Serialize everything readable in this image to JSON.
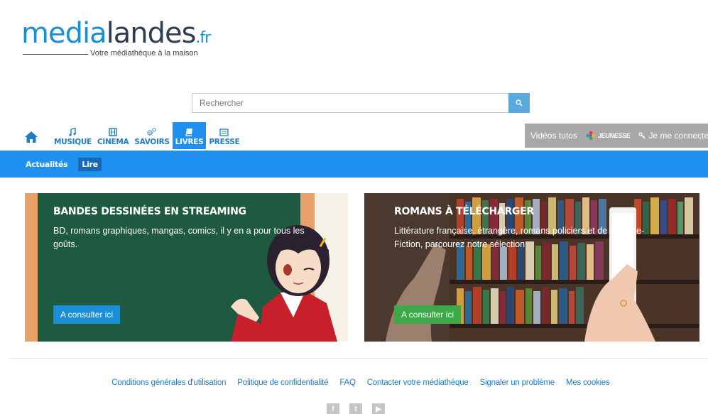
{
  "logo": {
    "part1": "media",
    "part2": "landes",
    "part3": ".fr",
    "tagline": "Votre médiathèque à la maison"
  },
  "search": {
    "placeholder": "Rechercher"
  },
  "nav": {
    "home_icon": "home-icon",
    "items": [
      {
        "label": "MUSIQUE",
        "icon": "music-note-icon"
      },
      {
        "label": "CINEMA",
        "icon": "film-icon"
      },
      {
        "label": "SAVOIRS",
        "icon": "gears-icon"
      },
      {
        "label": "LIVRES",
        "icon": "book-icon",
        "active": true
      },
      {
        "label": "PRESSE",
        "icon": "newspaper-icon"
      }
    ]
  },
  "tools": {
    "tutos": "Vidéos tutos",
    "jeunesse": "JEUNESSE",
    "connect": "Je me connecte"
  },
  "subnav": {
    "items": [
      {
        "label": "Actualités"
      },
      {
        "label": "Lire",
        "active": true
      }
    ]
  },
  "cards": [
    {
      "title": "BANDES DESSINÉES EN STREAMING",
      "description": "BD, romans graphiques, mangas, comics, il y en a pour tous les goûts.",
      "button": "A consulter ici",
      "button_color": "#1c8ed6"
    },
    {
      "title": "ROMANS À TÉLÉCHARGER",
      "description": "Littérature française, étrangère, romans policiers et de Science-Fiction, parcourez notre sélection",
      "button": "A consulter ici",
      "button_color": "#3ca84a"
    }
  ],
  "footer": {
    "links": [
      "Conditions générales d'utilisation",
      "Politique de confidentialité",
      "FAQ",
      "Contacter votre médiathèque",
      "Signaler un problème",
      "Mes cookies"
    ],
    "social": [
      "facebook-icon",
      "twitter-icon",
      "youtube-icon"
    ]
  },
  "colors": {
    "primary_blue": "#1f8ff0",
    "nav_text": "#1f7cc6",
    "tools_bg": "#a8a8a8"
  }
}
